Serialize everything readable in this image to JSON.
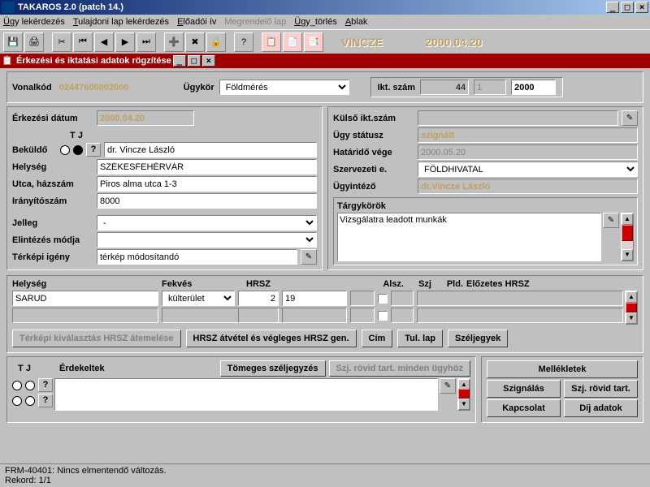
{
  "window": {
    "title": "TAKAROS 2.0 (patch 14.)"
  },
  "menu": {
    "m1": "Ügy lekérdezés",
    "m2": "Tulajdoni lap lekérdezés",
    "m3": "Előadói ív",
    "m4": "Megrendelő lap",
    "m5": "Ügy_törlés",
    "m6": "Ablak"
  },
  "toolbar": {
    "user": "VINCZE",
    "date": "2000.04.20"
  },
  "subwindow": {
    "title": "Érkezési és iktatási adatok rögzítése"
  },
  "top": {
    "vonalkod_lbl": "Vonalkód",
    "vonalkod": "02447600002000",
    "ugykor_lbl": "Ügykör",
    "ugykor": "Földmérés",
    "iktszam_lbl": "Ikt. szám",
    "ikt1": "44",
    "ikt2": "1",
    "ikt3": "2000"
  },
  "left": {
    "erkdatum_lbl": "Érkezési dátum",
    "erkdatum": "2000.04.20",
    "tj_lbl": "T J",
    "bekuldo_lbl": "Beküldő",
    "bekuldo": "dr. Vincze László",
    "helyseg_lbl": "Helység",
    "helyseg": "SZÉKESFEHÉRVÁR",
    "utca_lbl": "Utca, házszám",
    "utca": "Piros alma utca 1-3",
    "irsz_lbl": "Irányítószám",
    "irsz": "8000",
    "jelleg_lbl": "Jelleg",
    "jelleg": "-",
    "elint_lbl": "Elintézés módja",
    "elint": "",
    "terkep_lbl": "Térképi igény",
    "terkep": "térkép módosítandó"
  },
  "right": {
    "kulso_lbl": "Külső ikt.szám",
    "kulso": "",
    "status_lbl": "Ügy státusz",
    "status": "szignált",
    "hatar_lbl": "Határidő vége",
    "hatar": "2000.05.20",
    "szerv_lbl": "Szervezeti e.",
    "szerv": "FÖLDHIVATAL",
    "ugyint_lbl": "Ügyintéző",
    "ugyint": "dr.Vincze László",
    "targy_lbl": "Tárgykörök",
    "targy": "Vizsgálatra leadott munkák"
  },
  "grid": {
    "h_helyseg": "Helység",
    "h_fekves": "Fekvés",
    "h_hrsz": "HRSZ",
    "h_alsz": "Alsz.",
    "h_szj": "Szj",
    "h_pld": "Pld.",
    "h_elozetes": "Előzetes HRSZ",
    "helyseg": "SARUD",
    "fekves": "külterület",
    "hrsz1": "2",
    "hrsz2": "19"
  },
  "buttons": {
    "terkepki": "Térképi kiválasztás HRSZ átemelése",
    "hrszatv": "HRSZ átvétel és végleges HRSZ gen.",
    "cim": "Cím",
    "tullap": "Tul. lap",
    "szeljegy": "Széljegyek",
    "tomeges": "Tömeges széljegyzés",
    "szjrovid": "Szj. rövid tart. minden ügyhöz",
    "mellek": "Mellékletek",
    "szignalas": "Szignálás",
    "szjrt": "Szj. rövid tart.",
    "kapcsolat": "Kapcsolat",
    "dij": "Díj adatok"
  },
  "bottom": {
    "tj_lbl": "T J",
    "erdek_lbl": "Érdekeltek"
  },
  "status": {
    "msg": "FRM-40401: Nincs elmentendő változás.",
    "rec": "Rekord: 1/1"
  }
}
